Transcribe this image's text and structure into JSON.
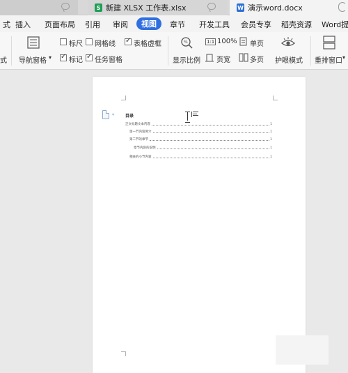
{
  "tabs": [
    {
      "label": "",
      "icon": "chat-icon"
    },
    {
      "label": "新建 XLSX 工作表.xlsx",
      "icon": "spreadsheet-icon",
      "badge": "S"
    },
    {
      "label": "演示word.docx",
      "icon": "document-icon",
      "badge": "W"
    }
  ],
  "menu": {
    "items": [
      "插入",
      "页面布局",
      "引用",
      "审阅",
      "视图",
      "章节",
      "开发工具",
      "会员专享",
      "稻壳资源",
      "Word提"
    ],
    "partial_left": "式",
    "active": "视图"
  },
  "ribbon": {
    "partial_left": "式",
    "nav_pane": "导航窗格",
    "ruler": {
      "label": "标尺",
      "checked": false
    },
    "gridlines": {
      "label": "网格线",
      "checked": false
    },
    "table_gridlines": {
      "label": "表格虚框",
      "checked": true
    },
    "marks": {
      "label": "标记",
      "checked": true
    },
    "task_pane": {
      "label": "任务窗格",
      "checked": true
    },
    "zoom_ratio": "显示比例",
    "zoom_100": "100%",
    "one_page": "单页",
    "page_width": "页宽",
    "multi_page": "多页",
    "eye_mode": "护眼模式",
    "arrange_windows": "重排窗口"
  },
  "document": {
    "toc_title": "目录",
    "toc": [
      {
        "text": "正文标题文本内容",
        "page": "1",
        "level": 1
      },
      {
        "text": "第一节内容简介",
        "page": "1",
        "level": 2
      },
      {
        "text": "第二节的章节",
        "page": "1",
        "level": 2
      },
      {
        "text": "章节内容的说明",
        "page": "1",
        "level": 3
      },
      {
        "text": "相关的小节内容",
        "page": "1",
        "level": 2
      }
    ]
  },
  "colors": {
    "accent": "#2f6fe0",
    "excel": "#1f9e55",
    "word": "#2d6fd6"
  }
}
